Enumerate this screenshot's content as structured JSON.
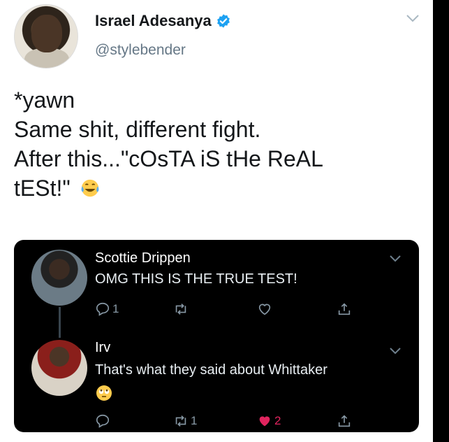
{
  "tweet": {
    "author_name": "Israel Adesanya",
    "author_handle": "@stylebender",
    "lines": [
      "*yawn",
      "Same shit, different fight.",
      "After this...\"cOsTA iS tHe ReAL",
      "tESt!\""
    ],
    "emoji": "face-with-tears-of-joy"
  },
  "embed": {
    "replies": [
      {
        "name": "Scottie Drippen",
        "text": "OMG THIS IS THE TRUE TEST!",
        "reply_count": "1",
        "retweet_count": "",
        "like_count": "",
        "liked": false
      },
      {
        "name": "Irv",
        "text": "That's what they said about Whittaker",
        "emoji": "face-with-rolling-eyes",
        "reply_count": "",
        "retweet_count": "1",
        "like_count": "2",
        "liked": true
      }
    ]
  },
  "colors": {
    "name": "#14171a",
    "handle": "#657786",
    "verified": "#1da1f2",
    "icons_dark": "#8899a6",
    "like": "#e0245e"
  }
}
